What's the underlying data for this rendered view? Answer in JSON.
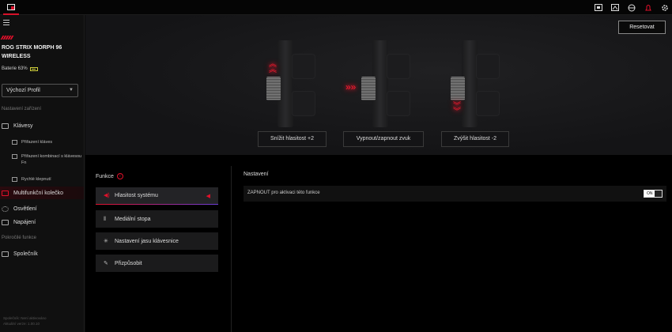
{
  "topbar": {
    "app_icon": "device-icon",
    "icons": [
      "keyboard-icon",
      "image-icon",
      "sync-icon",
      "notification-icon",
      "gear-icon"
    ],
    "accent": "#d8112a"
  },
  "sidebar": {
    "device_name": "ROG STRIX MORPH 96 WIRELESS",
    "battery": "Baterie 63%",
    "profile": "Výchozí Profil",
    "section_device": "Nastavení zařízení",
    "items": {
      "keys": "Klávesy",
      "key_assign": "Přiřazení kláves",
      "fn_combo": "Přiřazení kombinací s klávesou Fn",
      "quick_click": "Rychlé klepnutí",
      "multiwheel": "Multifunkční kolečko",
      "lighting": "Osvětlení",
      "power": "Napájení",
      "section_advanced": "Pokročilé funkce",
      "companion": "Společník"
    },
    "footer_line1": "Společník: Není aktivováno",
    "footer_line2": "Aktuální verze: 1.00.10"
  },
  "stage": {
    "reset": "Resetovat",
    "labels": [
      "Snížit hlasitost +2",
      "Vypnout/zapnout zvuk",
      "Zvýšit hlasitost -2"
    ]
  },
  "functions": {
    "title": "Funkce",
    "items": [
      "Hlasitost systému",
      "Mediální stopa",
      "Nastavení jasu klávesnice",
      "Přizpůsobit"
    ]
  },
  "settings": {
    "title": "Nastavení",
    "row_label": "ZAPNOUT pro aktivaci této funkce",
    "toggle": "ON"
  }
}
